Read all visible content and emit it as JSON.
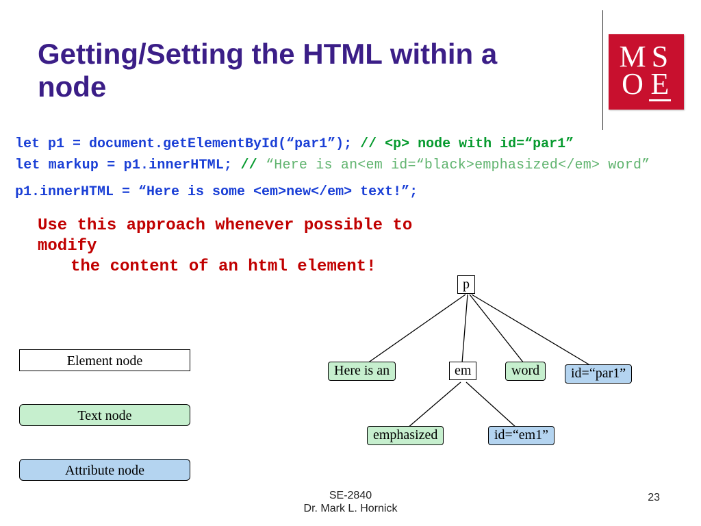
{
  "title": "Getting/Setting the HTML within a node",
  "logo": {
    "letters": [
      "M",
      "S",
      "O",
      "E"
    ]
  },
  "code": {
    "l1_blue": "let p1 = document.getElementById(“par1”); ",
    "l1_green": "// <p> node with id=“par1”",
    "l2_blue": "let markup = p1.innerHTML; ",
    "l2_slash": "// ",
    "l2_green": "“Here is an<em id=“black>emphasized</em> word”",
    "l3_blue": "p1.innerHTML = “Here is some <em>new</em> text!”;"
  },
  "advice_line1": "Use this approach whenever possible to modify",
  "advice_line2": "the content of an html element!",
  "legend": {
    "element": "Element node",
    "text": "Text node",
    "attribute": "Attribute node"
  },
  "tree": {
    "p": "p",
    "here": "Here is an",
    "em": "em",
    "word": "word",
    "idpar1": "id=“par1”",
    "emphasized": "emphasized",
    "idem1": "id=“em1”"
  },
  "footer": {
    "course": "SE-2840",
    "author": "Dr. Mark L. Hornick"
  },
  "page": "23"
}
